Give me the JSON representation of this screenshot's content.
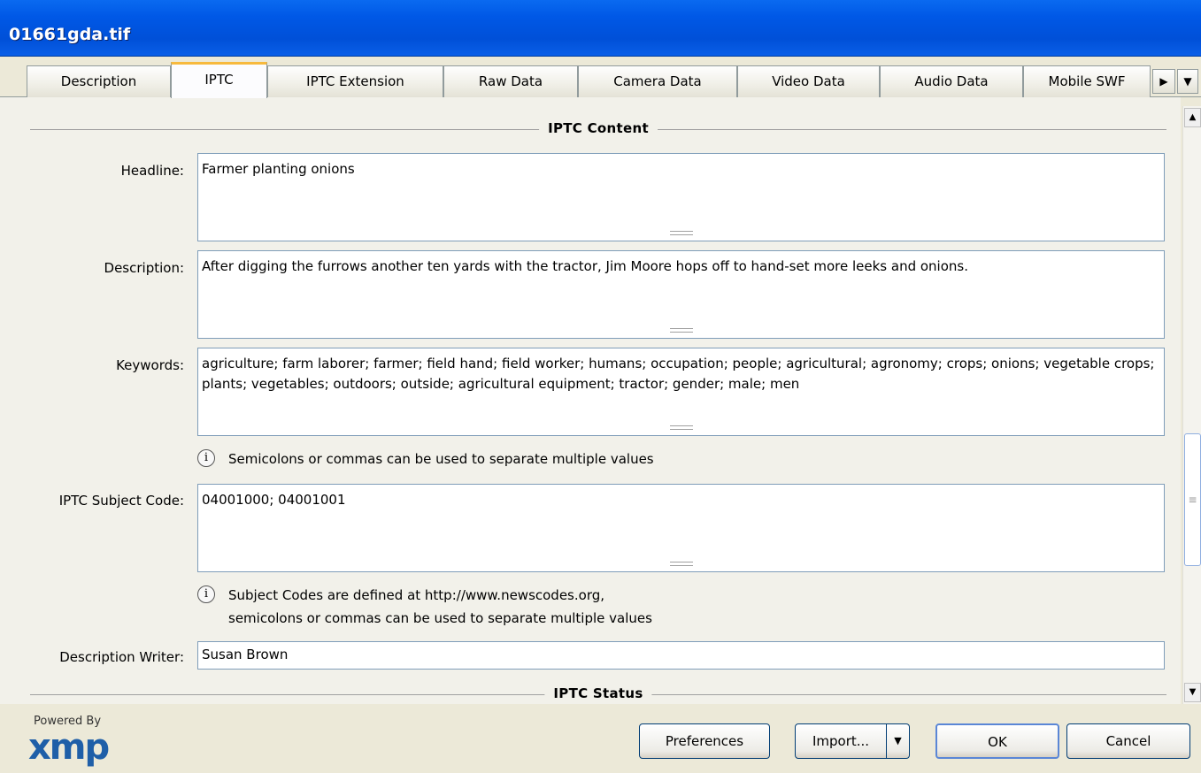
{
  "window": {
    "title": "01661gda.tif"
  },
  "tabs": [
    {
      "label": "Description"
    },
    {
      "label": "IPTC"
    },
    {
      "label": "IPTC Extension"
    },
    {
      "label": "Raw Data"
    },
    {
      "label": "Camera Data"
    },
    {
      "label": "Video Data"
    },
    {
      "label": "Audio Data"
    },
    {
      "label": "Mobile SWF"
    }
  ],
  "active_tab": "IPTC",
  "sections": {
    "content_header": "IPTC Content",
    "status_header": "IPTC Status"
  },
  "fields": {
    "headline": {
      "label": "Headline:",
      "value": "Farmer planting onions"
    },
    "description": {
      "label": "Description:",
      "value": "After digging the furrows another ten yards with the tractor, Jim Moore hops off to hand-set more leeks and onions."
    },
    "keywords": {
      "label": "Keywords:",
      "value": "agriculture; farm laborer; farmer; field hand; field worker; humans; occupation; people; agricultural; agronomy; crops; onions; vegetable crops; plants; vegetables; outdoors; outside; agricultural equipment; tractor; gender; male; men"
    },
    "keywords_hint": "Semicolons or commas can be used to separate multiple values",
    "subject_code": {
      "label": "IPTC Subject Code:",
      "value": "04001000; 04001001"
    },
    "subject_hint_line1": "Subject Codes are defined at http://www.newscodes.org,",
    "subject_hint_line2": "semicolons or commas can be used to separate multiple values",
    "description_writer": {
      "label": "Description Writer:",
      "value": "Susan Brown"
    }
  },
  "footer": {
    "powered_by": "Powered By",
    "logo_text": "xmp",
    "preferences": "Preferences",
    "import": "Import...",
    "ok": "OK",
    "cancel": "Cancel"
  },
  "icons": {
    "info": "info-icon",
    "tab_scroll_right": "triangle-right-icon",
    "tab_menu": "triangle-down-icon"
  }
}
